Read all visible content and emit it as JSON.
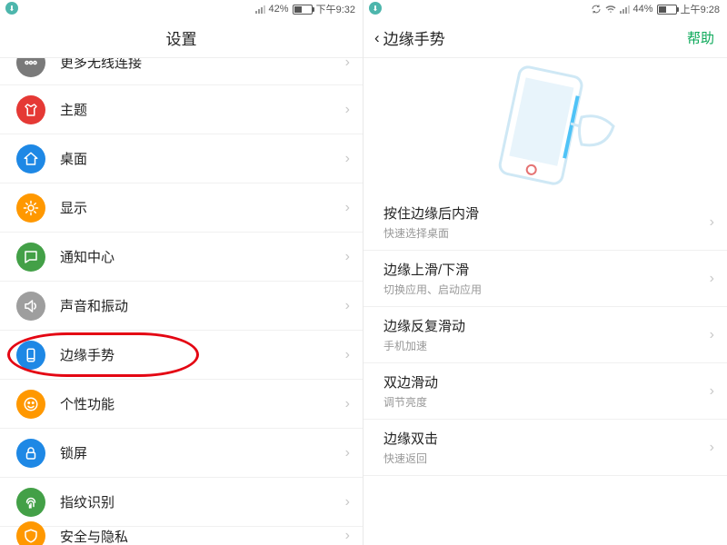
{
  "left": {
    "status": {
      "battery_pct": "42%",
      "time": "下午9:32"
    },
    "title": "设置",
    "items": [
      {
        "label": "更多无线连接",
        "color": "#7a7a7a",
        "icon": "dots"
      },
      {
        "label": "主题",
        "color": "#e53935",
        "icon": "shirt"
      },
      {
        "label": "桌面",
        "color": "#1e88e5",
        "icon": "home"
      },
      {
        "label": "显示",
        "color": "#ff9800",
        "icon": "sun"
      },
      {
        "label": "通知中心",
        "color": "#43a047",
        "icon": "chat"
      },
      {
        "label": "声音和振动",
        "color": "#9e9e9e",
        "icon": "speaker"
      },
      {
        "label": "边缘手势",
        "color": "#1e88e5",
        "icon": "phone"
      },
      {
        "label": "个性功能",
        "color": "#ff9800",
        "icon": "smile"
      },
      {
        "label": "锁屏",
        "color": "#1e88e5",
        "icon": "lock"
      },
      {
        "label": "指纹识别",
        "color": "#43a047",
        "icon": "fingerprint"
      },
      {
        "label": "安全与隐私",
        "color": "#ff9800",
        "icon": "shield"
      }
    ]
  },
  "right": {
    "status": {
      "battery_pct": "44%",
      "time": "上午9:28"
    },
    "back_label": "边缘手势",
    "help": "帮助",
    "gestures": [
      {
        "title": "按住边缘后内滑",
        "sub": "快速选择桌面"
      },
      {
        "title": "边缘上滑/下滑",
        "sub": "切换应用、启动应用"
      },
      {
        "title": "边缘反复滑动",
        "sub": "手机加速"
      },
      {
        "title": "双边滑动",
        "sub": "调节亮度"
      },
      {
        "title": "边缘双击",
        "sub": "快速返回"
      }
    ]
  },
  "colors": {
    "accent": "#0aa858",
    "highlight": "#e40613"
  }
}
